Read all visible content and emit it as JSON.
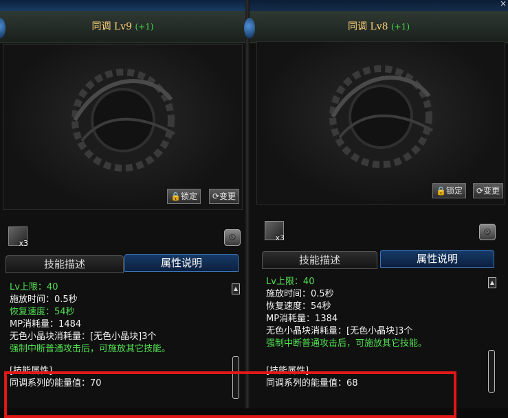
{
  "window": {
    "close_glyph": "×"
  },
  "left": {
    "title_name": "同调 Lv9",
    "title_plus": "(+1)",
    "lock_button": "🔒锁定",
    "change_button": "⟳变更",
    "skill_count": "x3",
    "tabs": {
      "desc": "技能描述",
      "attr": "属性说明"
    },
    "lines": {
      "lv_cap": "Lv上限：40",
      "cast_time": "施放时间：0.5秒",
      "recover": "恢复速度：54秒",
      "mp": "MP消耗量：1484",
      "crystal": "无色小晶块消耗量：[无色小晶块]3个",
      "cancel": "强制中断普通攻击后，可施放其它技能。",
      "attr_title": "[技能属性]",
      "attr_energy": "同调系列的能量值：70"
    }
  },
  "right": {
    "title_name": "同调 Lv8",
    "title_plus": "(+1)",
    "lock_button": "🔒锁定",
    "change_button": "⟳变更",
    "skill_count": "x3",
    "tabs": {
      "desc": "技能描述",
      "attr": "属性说明"
    },
    "lines": {
      "lv_cap": "Lv上限：40",
      "cast_time": "施放时间：0.5秒",
      "recover": "恢复速度：54秒",
      "mp": "MP消耗量：1384",
      "crystal": "无色小晶块消耗量：[无色小晶块]3个",
      "cancel": "强制中断普通攻击后，可施放其它技能。",
      "attr_title": "[技能属性]",
      "attr_energy": "同调系列的能量值：68"
    }
  },
  "icons": [
    "clock-icon",
    "lock-icon",
    "refresh-icon",
    "scroll-up-icon",
    "dungeon-fighter-logo"
  ],
  "colors": {
    "green": "#52e052",
    "gold": "#ffd27a",
    "highlight": "#e01818",
    "tab_active": "#163a66"
  }
}
